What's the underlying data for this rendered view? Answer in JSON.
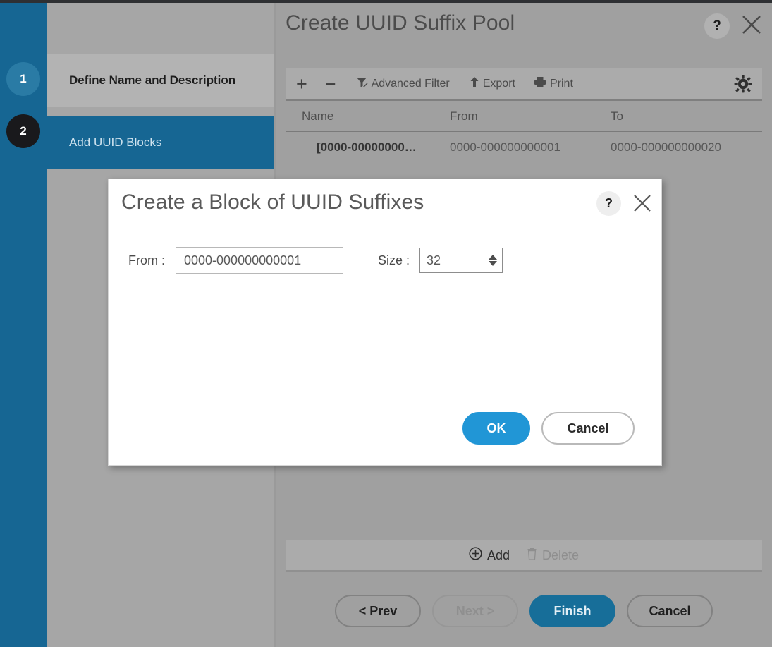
{
  "wizard": {
    "steps": [
      {
        "number": "1",
        "label": "Define Name and Description",
        "state": "complete"
      },
      {
        "number": "2",
        "label": "Add UUID Blocks",
        "state": "active"
      }
    ],
    "footer_buttons": [
      {
        "label": "< Prev",
        "state": "enabled"
      },
      {
        "label": "Next >",
        "state": "disabled"
      },
      {
        "label": "Finish",
        "state": "primary"
      },
      {
        "label": "Cancel",
        "state": "enabled"
      }
    ]
  },
  "panel": {
    "title": "Create UUID Suffix Pool",
    "help_label": "?",
    "close_label": "close-icon",
    "toolbar": {
      "add_label": "+",
      "remove_label": "−",
      "advanced_filter_label": "Advanced Filter",
      "export_label": "Export",
      "print_label": "Print",
      "settings_label": "gear-icon"
    },
    "table": {
      "columns": [
        "Name",
        "From",
        "To"
      ],
      "rows": [
        {
          "name": "[0000-00000000…",
          "from": "0000-000000000001",
          "to": "0000-000000000020"
        }
      ]
    },
    "actions": {
      "add_label": "Add",
      "delete_label": "Delete",
      "delete_state": "disabled"
    }
  },
  "modal": {
    "title": "Create a Block of UUID Suffixes",
    "help_label": "?",
    "close_label": "close-icon",
    "from_label": "From :",
    "from_value": "0000-000000000001",
    "from_placeholder": "0000-000000000001",
    "size_label": "Size :",
    "size_value": "32",
    "size_placeholder": "32",
    "ok_label": "OK",
    "cancel_label": "Cancel"
  },
  "colors": {
    "rail_blue": "#166693",
    "active_step_blue": "#166693",
    "primary_blue": "#176e99",
    "ok_blue": "#2196d6",
    "backdrop_grey": "#9d9d9d"
  }
}
